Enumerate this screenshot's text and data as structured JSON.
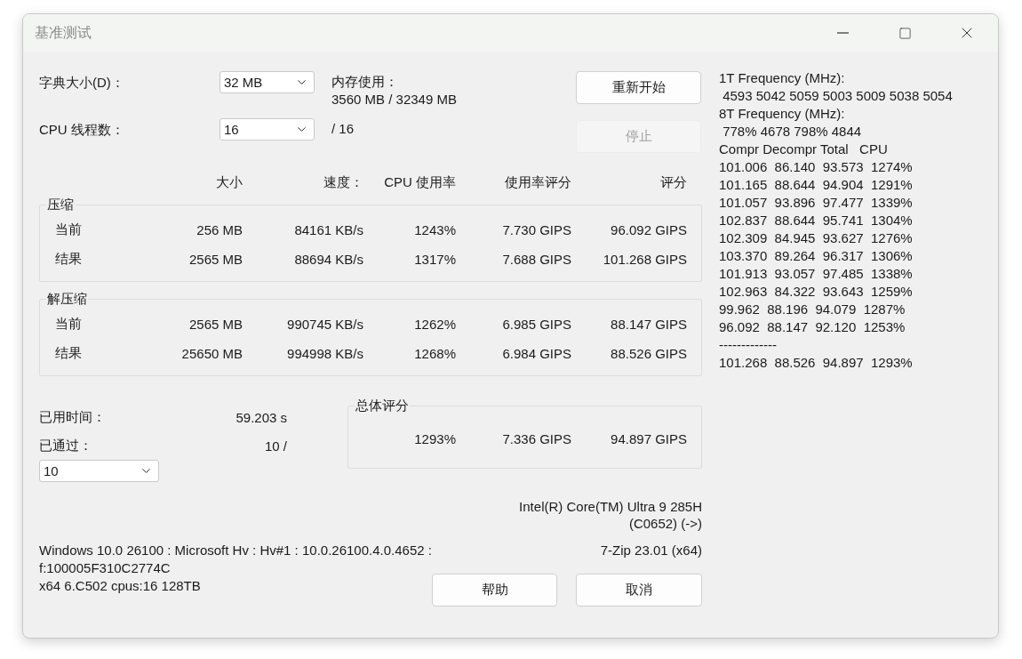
{
  "window": {
    "title": "基准测试"
  },
  "settings": [
    {
      "label": "字典大小(D)：",
      "value": "32 MB"
    },
    {
      "label": "CPU 线程数：",
      "value": "16",
      "suffix": "/ 16"
    }
  ],
  "memory": {
    "label": "内存使用：",
    "value": "3560 MB / 32349 MB"
  },
  "buttons": [
    {
      "label": "重新开始",
      "disabled": false
    },
    {
      "label": "停止",
      "disabled": true
    }
  ],
  "columns": [
    "大小",
    "速度：",
    "CPU 使用率",
    "使用率评分",
    "评分"
  ],
  "groups": [
    {
      "title": "压缩",
      "rows": [
        {
          "label": "当前",
          "cells": [
            "256 MB",
            "84161 KB/s",
            "1243%",
            "7.730 GIPS",
            "96.092 GIPS"
          ]
        },
        {
          "label": "结果",
          "cells": [
            "2565 MB",
            "88694 KB/s",
            "1317%",
            "7.688 GIPS",
            "101.268 GIPS"
          ]
        }
      ]
    },
    {
      "title": "解压缩",
      "rows": [
        {
          "label": "当前",
          "cells": [
            "2565 MB",
            "990745 KB/s",
            "1262%",
            "6.985 GIPS",
            "88.147 GIPS"
          ]
        },
        {
          "label": "结果",
          "cells": [
            "25650 MB",
            "994998 KB/s",
            "1268%",
            "6.984 GIPS",
            "88.526 GIPS"
          ]
        }
      ]
    }
  ],
  "elapsed": {
    "label": "已用时间：",
    "value": "59.203 s"
  },
  "passed": {
    "label": "已通过：",
    "value": "10 /",
    "select": "10"
  },
  "overall": {
    "title": "总体评分",
    "cells": [
      "1293%",
      "7.336 GIPS",
      "94.897 GIPS"
    ]
  },
  "cpu_name": [
    "Intel(R) Core(TM) Ultra 9 285H",
    "(C0652) (->)"
  ],
  "system_info": [
    "Windows 10.0 26100 : Microsoft Hv : Hv#1 : 10.0.26100.4.0.4652 :",
    "f:100005F310C2774C",
    "x64 6.C502 cpus:16 128TB"
  ],
  "version": "7-Zip 23.01 (x64)",
  "footer_buttons": [
    "帮助",
    "取消"
  ],
  "log": [
    "1T Frequency (MHz):",
    " 4593 5042 5059 5003 5009 5038 5054",
    "8T Frequency (MHz):",
    " 778% 4678 798% 4844",
    "Compr Decompr Total   CPU",
    "101.006  86.140  93.573  1274%",
    "101.165  88.644  94.904  1291%",
    "101.057  93.896  97.477  1339%",
    "102.837  88.644  95.741  1304%",
    "102.309  84.945  93.627  1276%",
    "103.370  89.264  96.317  1306%",
    "101.913  93.057  97.485  1338%",
    "102.963  84.322  93.643  1259%",
    "99.962  88.196  94.079  1287%",
    "96.092  88.147  92.120  1253%",
    "-------------",
    "101.268  88.526  94.897  1293%"
  ]
}
